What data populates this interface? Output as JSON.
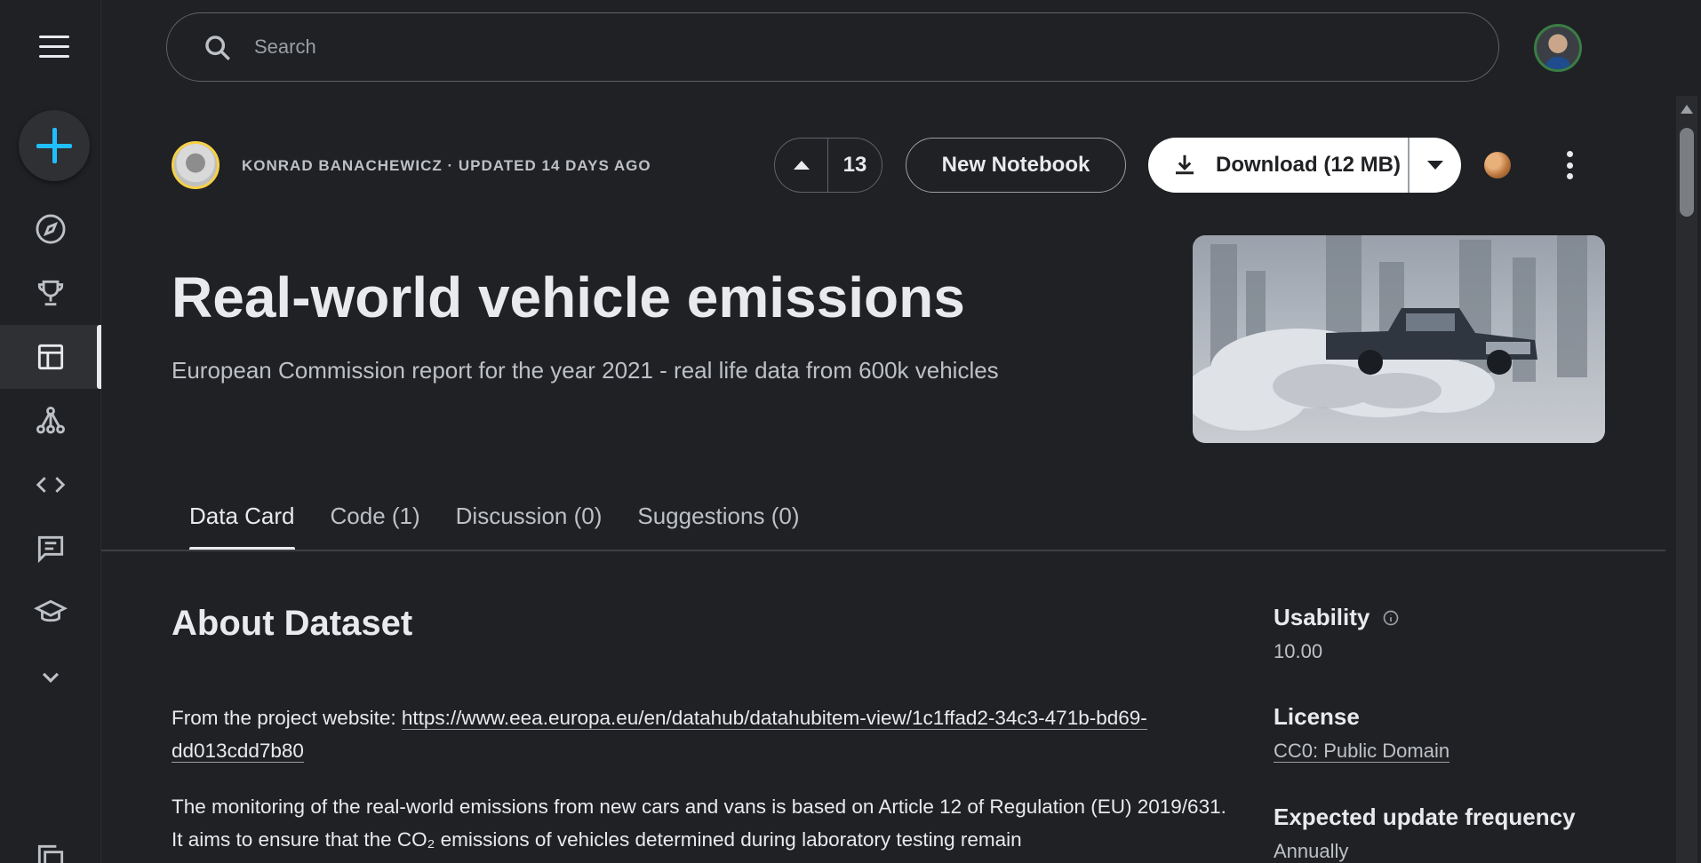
{
  "search": {
    "placeholder": "Search"
  },
  "sidebar": {
    "items": [
      {
        "name": "explore",
        "icon": "compass-icon"
      },
      {
        "name": "competitions",
        "icon": "trophy-icon"
      },
      {
        "name": "datasets",
        "icon": "table-icon",
        "active": true
      },
      {
        "name": "models",
        "icon": "models-icon"
      },
      {
        "name": "code",
        "icon": "code-icon"
      },
      {
        "name": "discussions",
        "icon": "comment-icon"
      },
      {
        "name": "learn",
        "icon": "school-icon"
      },
      {
        "name": "more",
        "icon": "chevron-down-icon"
      }
    ]
  },
  "header": {
    "owner_line": "KONRAD BANACHEWICZ · UPDATED 14 DAYS AGO",
    "vote_count": "13",
    "new_notebook_label": "New Notebook",
    "download_label": "Download (12 MB)"
  },
  "dataset": {
    "title": "Real-world vehicle emissions",
    "subtitle": "European Commission report for the year 2021 - real life data from 600k vehicles"
  },
  "tabs": [
    {
      "label": "Data Card",
      "active": true
    },
    {
      "label": "Code (1)"
    },
    {
      "label": "Discussion (0)"
    },
    {
      "label": "Suggestions (0)"
    }
  ],
  "about": {
    "heading": "About Dataset",
    "intro_text": "From the project website: ",
    "link_text": "https://www.eea.europa.eu/en/datahub/datahubitem-view/1c1ffad2-34c3-471b-bd69-dd013cdd7b80",
    "paragraph2": "The monitoring of the real-world emissions from new cars and vans is based on Article 12 of Regulation (EU) 2019/631. It aims to ensure that the CO₂ emissions of vehicles determined during laboratory testing remain"
  },
  "meta": {
    "usability_label": "Usability",
    "usability_value": "10.00",
    "license_label": "License",
    "license_value": "CC0: Public Domain",
    "frequency_label": "Expected update frequency",
    "frequency_value": "Annually"
  },
  "colors": {
    "accent": "#20beff",
    "background": "#202124",
    "text": "#e8eaed"
  }
}
